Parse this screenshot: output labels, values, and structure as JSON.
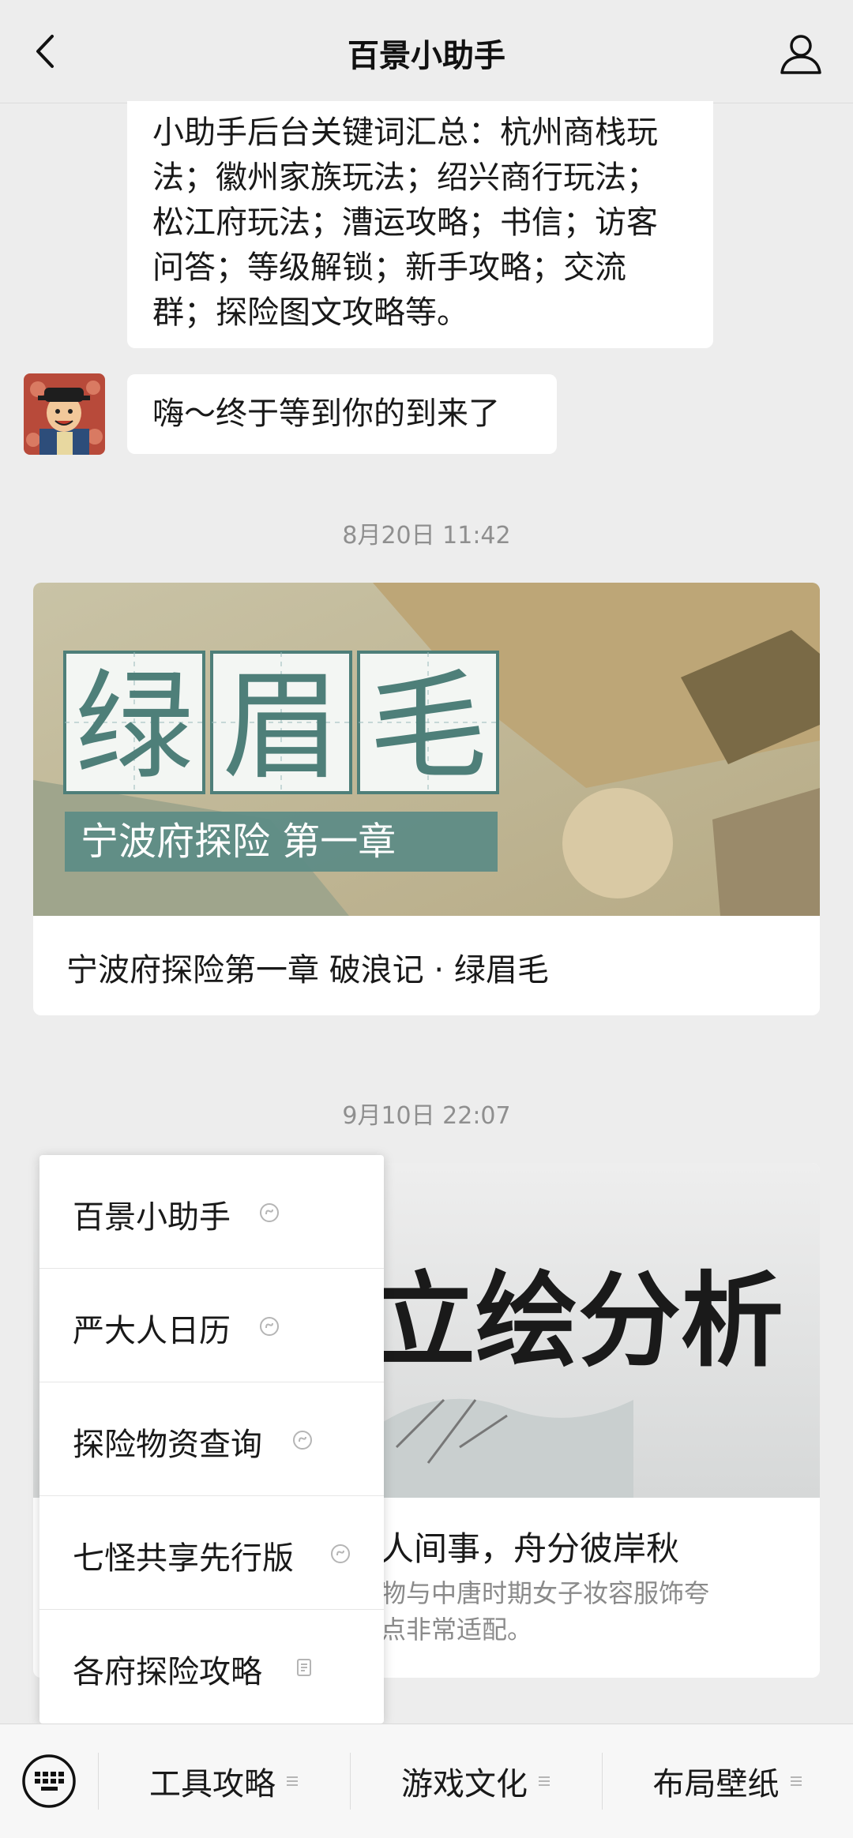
{
  "header": {
    "title": "百景小助手"
  },
  "messages": {
    "keywords_text": "小助手后台关键词汇总：杭州商栈玩法；徽州家族玩法；绍兴商行玩法；松江府玩法；漕运攻略；书信；访客问答；等级解锁；新手攻略；交流群；探险图文攻略等。",
    "greeting": "嗨～终于等到你的到来了"
  },
  "timestamps": [
    "8月20日 11:42",
    "9月10日 22:07"
  ],
  "article1": {
    "banner_chars": [
      "绿",
      "眉",
      "毛"
    ],
    "banner_subtitle": "宁波府探险  第一章",
    "caption": "宁波府探险第一章  破浪记 · 绿眉毛"
  },
  "article2": {
    "banner_title": "立绘分析",
    "caption": "人间事，舟分彼岸秋",
    "desc_line1": "物与中唐时期女子妆容服饰夸",
    "desc_line2": "点非常适配。"
  },
  "popup_menu": {
    "items": [
      {
        "label": "百景小助手",
        "icon": "mini-program-icon"
      },
      {
        "label": "严大人日历",
        "icon": "mini-program-icon"
      },
      {
        "label": "探险物资查询",
        "icon": "mini-program-icon"
      },
      {
        "label": "七怪共享先行版",
        "icon": "mini-program-icon"
      },
      {
        "label": "各府探险攻略",
        "icon": "article-icon"
      }
    ]
  },
  "bottom_menu": {
    "tabs": [
      "工具攻略",
      "游戏文化",
      "布局壁纸"
    ]
  },
  "colors": {
    "background": "#ededed",
    "bubble": "#ffffff",
    "banner_teal": "#4e7f79"
  }
}
